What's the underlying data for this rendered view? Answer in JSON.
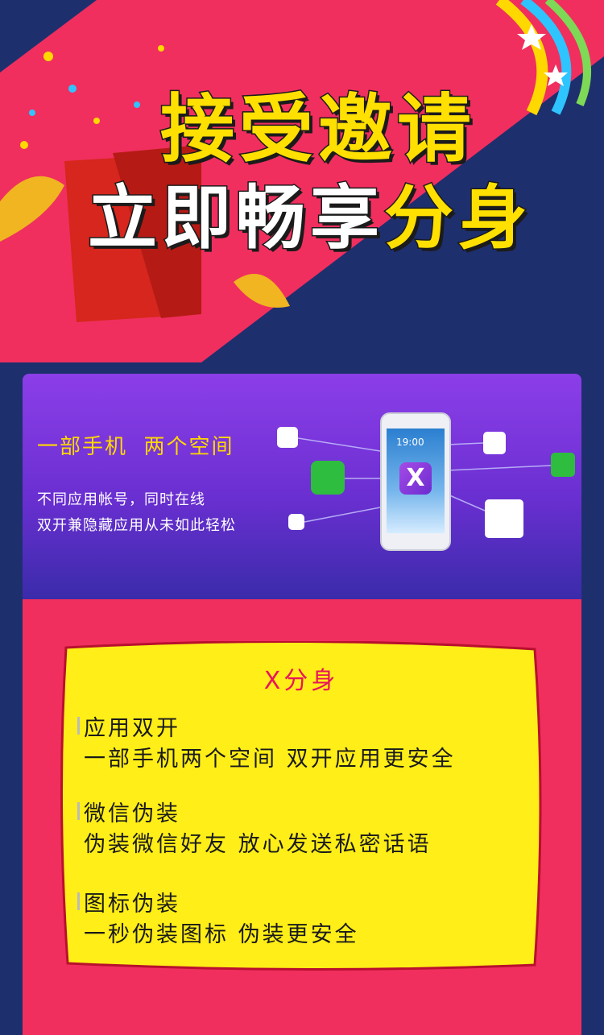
{
  "hero": {
    "headline_line1": "接受邀请",
    "headline_line2_white": "立即畅享",
    "headline_line2_yellow": "分身"
  },
  "panel": {
    "tagline_part1": "一部手机",
    "tagline_part2": "两个空间",
    "desc_line1": "不同应用帐号，同时在线",
    "desc_line2": "双开兼隐藏应用从未如此轻松",
    "phone_time": "19:00",
    "phone_logo": "X"
  },
  "card": {
    "title": "X分身",
    "features": [
      {
        "heading": "应用双开",
        "detail": "一部手机两个空间   双开应用更安全"
      },
      {
        "heading": "微信伪装",
        "detail": "伪装微信好友  放心发送私密话语"
      },
      {
        "heading": "图标伪装",
        "detail": "一秒伪装图标  伪装更安全"
      }
    ]
  },
  "colors": {
    "background": "#1e2f6e",
    "hero_pink": "#f02f5e",
    "panel_purple": "#7a38de",
    "card_yellow": "#ffee17",
    "accent_yellow": "#ffd800",
    "title_pink": "#e8155a"
  }
}
